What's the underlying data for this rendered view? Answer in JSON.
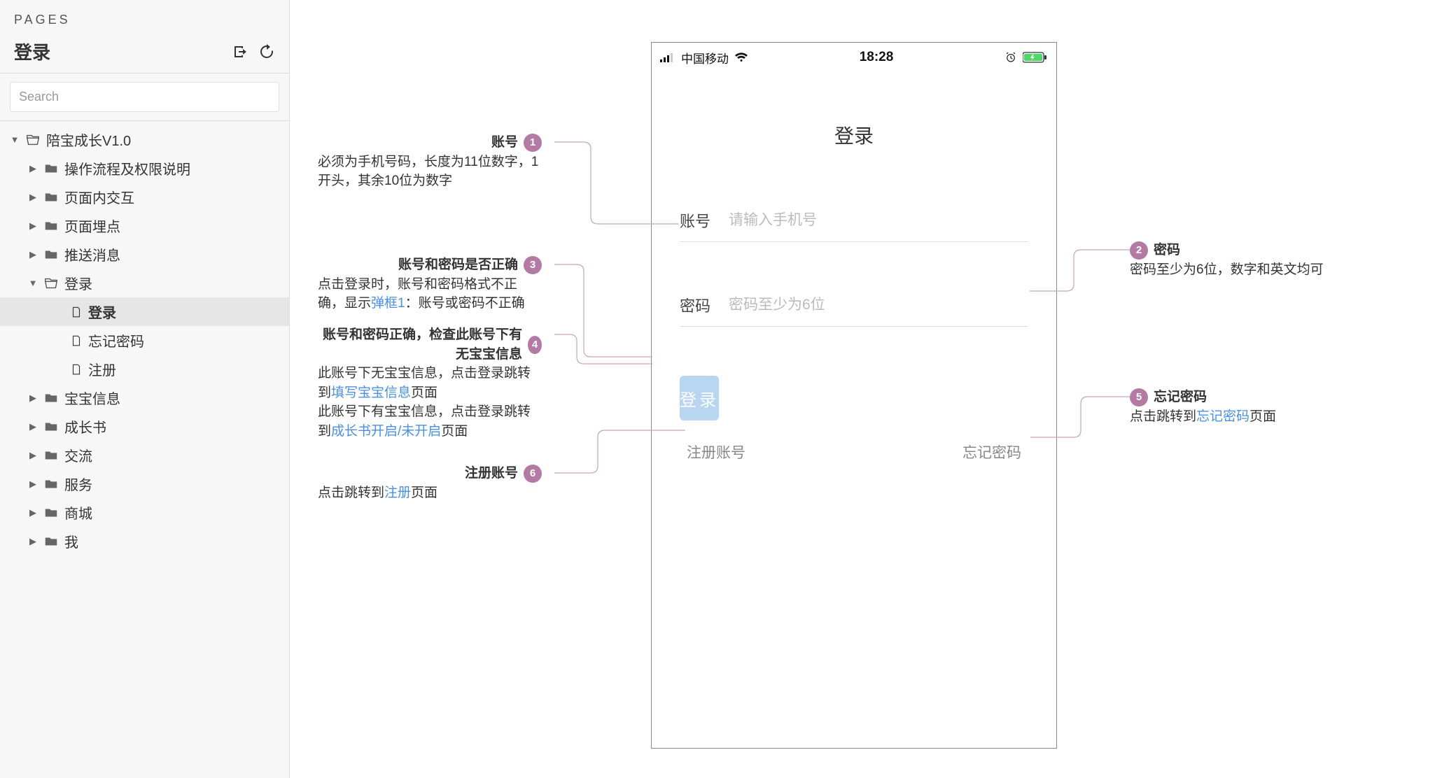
{
  "sidebar": {
    "pages_label": "PAGES",
    "title": "登录",
    "search_placeholder": "Search",
    "tree": {
      "root": {
        "label": "陪宝成长V1.0"
      },
      "items": [
        {
          "label": "操作流程及权限说明"
        },
        {
          "label": "页面内交互"
        },
        {
          "label": "页面埋点"
        },
        {
          "label": "推送消息"
        },
        {
          "label": "登录",
          "children": [
            {
              "label": "登录"
            },
            {
              "label": "忘记密码"
            },
            {
              "label": "注册"
            }
          ]
        },
        {
          "label": "宝宝信息"
        },
        {
          "label": "成长书"
        },
        {
          "label": "交流"
        },
        {
          "label": "服务"
        },
        {
          "label": "商城"
        },
        {
          "label": "我"
        }
      ]
    }
  },
  "phone": {
    "carrier": "中国移动",
    "time": "18:28",
    "title": "登录",
    "account_label": "账号",
    "account_placeholder": "请输入手机号",
    "password_label": "密码",
    "password_placeholder": "密码至少为6位",
    "login_button": "登录",
    "register_link": "注册账号",
    "forgot_link": "忘记密码"
  },
  "annotations": {
    "a1": {
      "num": "1",
      "title": "账号",
      "body": "必须为手机号码，长度为11位数字，1开头，其余10位为数字"
    },
    "a2": {
      "num": "2",
      "title": "密码",
      "body_prefix": "密码至少为6位，数字和英文均可"
    },
    "a3": {
      "num": "3",
      "title": "账号和密码是否正确",
      "body_p1": "点击登录时，账号和密码格式不正确，显示",
      "link1": "弹框1",
      "body_p2": "：账号或密码不正确"
    },
    "a4": {
      "num": "4",
      "title": "账号和密码正确，检查此账号下有无宝宝信息",
      "l1a": "此账号下无宝宝信息，点击登录跳转到",
      "l1_link": "填写宝宝信息",
      "l1b": "页面",
      "l2a": "此账号下有宝宝信息，点击登录跳转到",
      "l2_link": "成长书开启/未开启",
      "l2b": "页面"
    },
    "a5": {
      "num": "5",
      "title": "忘记密码",
      "body_a": "点击跳转到",
      "link": "忘记密码",
      "body_b": "页面"
    },
    "a6": {
      "num": "6",
      "title": "注册账号",
      "body_a": "点击跳转到",
      "link": "注册",
      "body_b": "页面"
    }
  }
}
